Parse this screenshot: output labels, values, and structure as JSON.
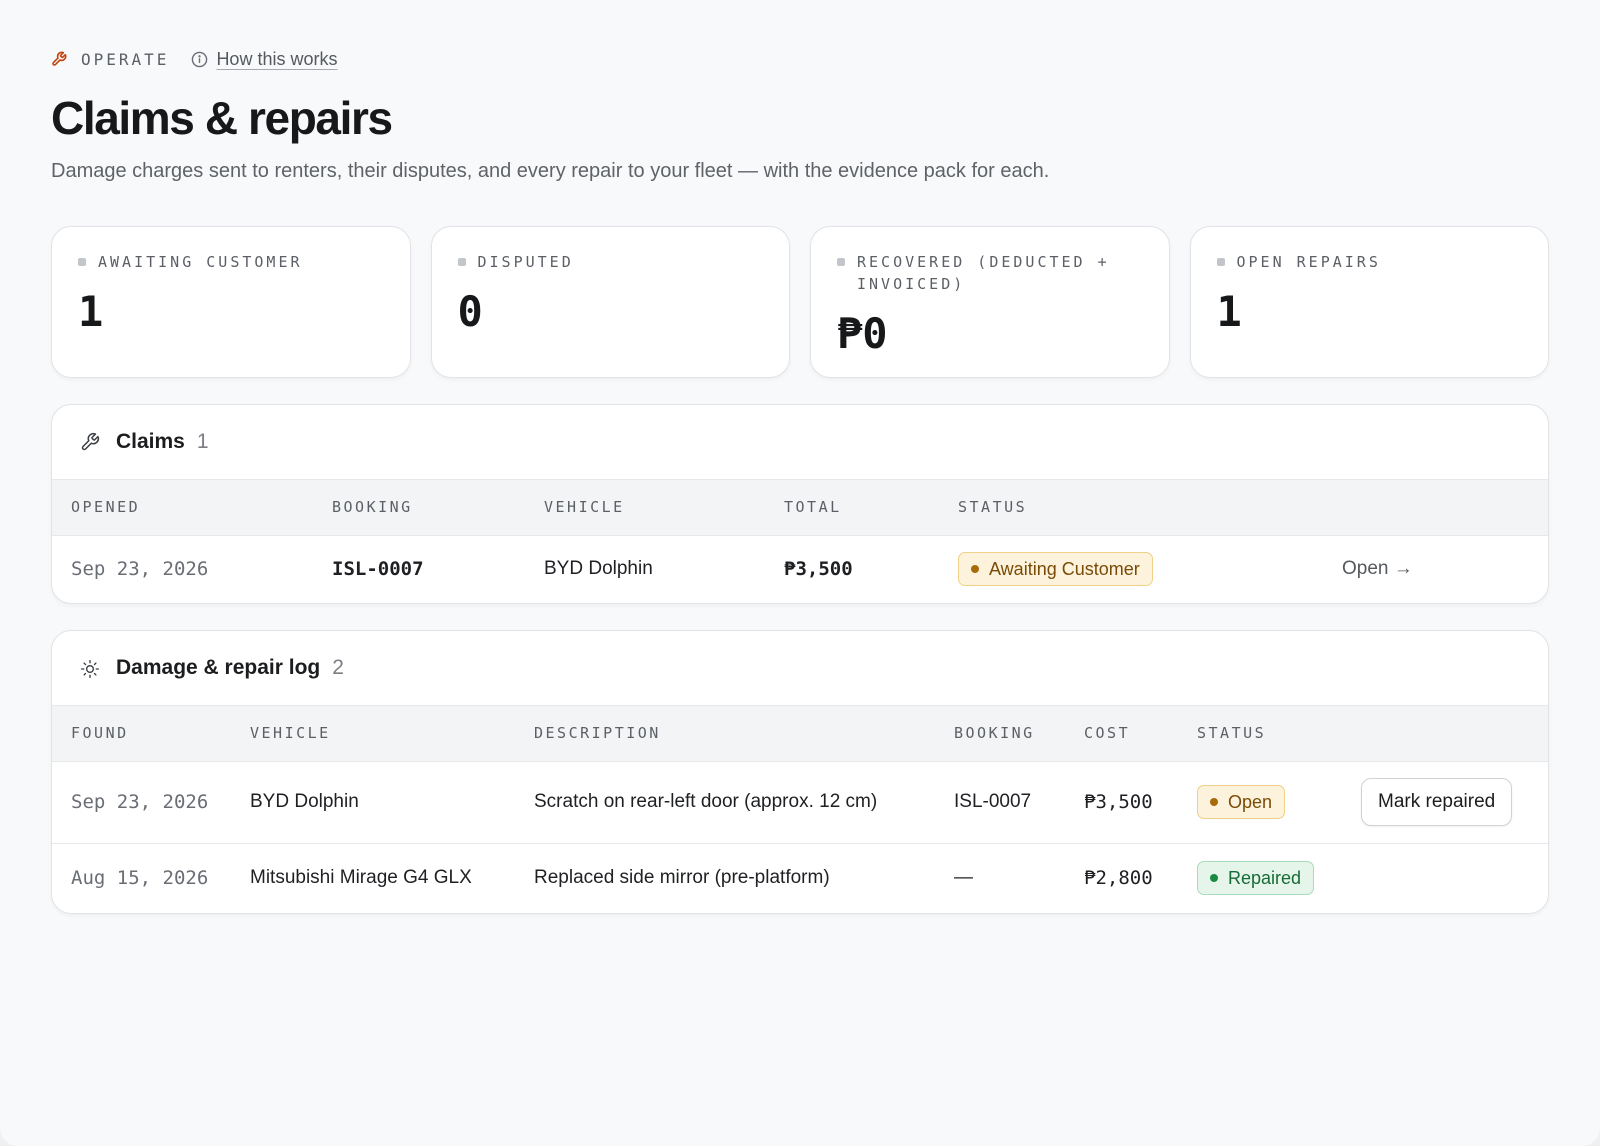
{
  "header": {
    "section": "OPERATE",
    "help_link": "How this works",
    "title": "Claims & repairs",
    "subtitle": "Damage charges sent to renters, their disputes, and every repair to your fleet — with the evidence pack for each."
  },
  "stats": [
    {
      "label": "AWAITING CUSTOMER",
      "value": "1"
    },
    {
      "label": "DISPUTED",
      "value": "0"
    },
    {
      "label": "RECOVERED (DEDUCTED + INVOICED)",
      "value": "₱0"
    },
    {
      "label": "OPEN REPAIRS",
      "value": "1"
    }
  ],
  "claims": {
    "title": "Claims",
    "count": "1",
    "columns": [
      "OPENED",
      "BOOKING",
      "VEHICLE",
      "TOTAL",
      "STATUS"
    ],
    "rows": [
      {
        "opened": "Sep 23, 2026",
        "booking": "ISL-0007",
        "vehicle": "BYD Dolphin",
        "total": "₱3,500",
        "status": "Awaiting Customer",
        "action": "Open →"
      }
    ]
  },
  "damage_log": {
    "title": "Damage & repair log",
    "count": "2",
    "columns": [
      "FOUND",
      "VEHICLE",
      "DESCRIPTION",
      "BOOKING",
      "COST",
      "STATUS"
    ],
    "rows": [
      {
        "found": "Sep 23, 2026",
        "vehicle": "BYD Dolphin",
        "description": "Scratch on rear-left door (approx. 12 cm)",
        "booking": "ISL-0007",
        "cost": "₱3,500",
        "status": "Open",
        "action": "Mark repaired"
      },
      {
        "found": "Aug 15, 2026",
        "vehicle": "Mitsubishi Mirage G4 GLX",
        "description": "Replaced side mirror (pre-platform)",
        "booking": "—",
        "cost": "₱2,800",
        "status": "Repaired"
      }
    ]
  },
  "icons": {
    "eyebrow": "wrench-icon",
    "help": "info-icon",
    "claims": "wrench-icon",
    "damage_log": "sun-icon"
  },
  "colors": {
    "accent": "#c2410c",
    "awaiting_badge": "#fdf3dc",
    "open_badge": "#fdf3dc",
    "repaired_badge": "#e5f5ea"
  }
}
